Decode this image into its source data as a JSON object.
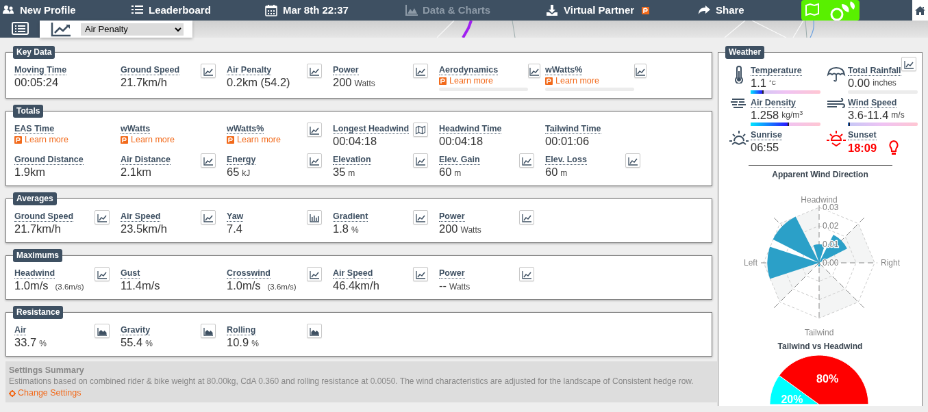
{
  "nav": [
    {
      "label": "New Profile",
      "disabled": false,
      "badge": false
    },
    {
      "label": "Leaderboard",
      "disabled": false,
      "badge": false
    },
    {
      "label": "Mar 8th 22:37",
      "disabled": false,
      "badge": false
    },
    {
      "label": "Data & Charts",
      "disabled": true,
      "badge": false
    },
    {
      "label": "Virtual Partner",
      "disabled": false,
      "badge": true
    },
    {
      "label": "Share",
      "disabled": false,
      "badge": false
    }
  ],
  "metric_selector": {
    "value": "Air Penalty"
  },
  "sections": [
    {
      "title": "Key Data",
      "items": [
        {
          "label": "Moving Time",
          "value": "00:05:24",
          "kind": "none"
        },
        {
          "label": "Ground Speed",
          "value": "21.7km/h",
          "kind": "line"
        },
        {
          "label": "Air Penalty",
          "value": "0.2km (54.2)",
          "kind": "line"
        },
        {
          "label": "Power",
          "value": "200",
          "unit": "Watts",
          "kind": "line"
        },
        {
          "label": "Aerodynamics",
          "link": "Learn more",
          "bar": true,
          "kind": "line"
        },
        {
          "label": "wWatts%",
          "link": "Learn more",
          "bar": true,
          "kind": "line"
        }
      ]
    },
    {
      "title": "Totals",
      "items": [
        {
          "label": "EAS Time",
          "link": "Learn more",
          "kind": "none"
        },
        {
          "label": "wWatts",
          "link": "Learn more",
          "kind": "none"
        },
        {
          "label": "wWatts%",
          "link": "Learn more",
          "kind": "line"
        },
        {
          "label": "Longest Headwind",
          "value": "00:04:18",
          "kind": "map"
        },
        {
          "label": "Headwind Time",
          "value": "00:04:18",
          "kind": "none"
        },
        {
          "label": "Tailwind Time",
          "value": "00:01:06",
          "kind": "none"
        },
        {
          "label": "Ground Distance",
          "value": "1.9km",
          "kind": "none"
        },
        {
          "label": "Air Distance",
          "value": "2.1km",
          "kind": "line"
        },
        {
          "label": "Energy",
          "value": "65",
          "unit": "kJ",
          "kind": "line"
        },
        {
          "label": "Elevation",
          "value": "35",
          "unit": "m",
          "kind": "line"
        },
        {
          "label": "Elev. Gain",
          "value": "60",
          "unit": "m",
          "kind": "line"
        },
        {
          "label": "Elev. Loss",
          "value": "60",
          "unit": "m",
          "kind": "line"
        }
      ]
    },
    {
      "title": "Averages",
      "items": [
        {
          "label": "Ground Speed",
          "value": "21.7km/h",
          "kind": "line"
        },
        {
          "label": "Air Speed",
          "value": "23.5km/h",
          "kind": "line"
        },
        {
          "label": "Yaw",
          "value": "7.4",
          "kind": "bar"
        },
        {
          "label": "Gradient",
          "value": "1.8",
          "unit": "%",
          "kind": "line"
        },
        {
          "label": "Power",
          "value": "200",
          "unit": "Watts",
          "kind": "line"
        }
      ]
    },
    {
      "title": "Maximums",
      "items": [
        {
          "label": "Headwind",
          "value": "1.0m/s",
          "note": "(3.6m/s)",
          "kind": "line"
        },
        {
          "label": "Gust",
          "value": "11.4m/s",
          "kind": "none"
        },
        {
          "label": "Crosswind",
          "value": "1.0m/s",
          "note": "(3.6m/s)",
          "kind": "line"
        },
        {
          "label": "Air Speed",
          "value": "46.4km/h",
          "kind": "line"
        },
        {
          "label": "Power",
          "value": "--",
          "unit": "Watts",
          "kind": "line"
        }
      ]
    },
    {
      "title": "Resistance",
      "items": [
        {
          "label": "Air",
          "value": "33.7",
          "unit": "%",
          "kind": "area"
        },
        {
          "label": "Gravity",
          "value": "55.4",
          "unit": "%",
          "kind": "area"
        },
        {
          "label": "Rolling",
          "value": "10.9",
          "unit": "%",
          "kind": "area"
        }
      ]
    }
  ],
  "settings": {
    "title": "Settings Summary",
    "text": "Estimations based on combined rider & bike weight at 80.00kg, CdA 0.360 and rolling resistance at 0.0050. The wind characteristics are adjusted for the landscape of Consistent hedge row.",
    "link": "Change Settings"
  },
  "weather": {
    "title": "Weather",
    "items": [
      {
        "label": "Temperature",
        "value": "1.1",
        "unit": "°C",
        "bar": {
          "kind": "gradient",
          "level": 0.19
        }
      },
      {
        "label": "Total Rainfall",
        "value": "0.00",
        "unit": "inches",
        "bar": {
          "kind": "plain",
          "level": 0
        }
      },
      {
        "label": "Air Density",
        "value": "1.258",
        "unit": "kg/m$^{3}$",
        "bar": {
          "kind": "gradient",
          "level": 0.55
        }
      },
      {
        "label": "Wind Speed",
        "value": "3.6-11.4",
        "unit": "m/s",
        "bar": {
          "kind": "gradient",
          "level": 0.03
        }
      },
      {
        "label": "Sunrise",
        "value": "06:55",
        "alert": false,
        "hint": false
      },
      {
        "label": "Sunset",
        "value": "18:09",
        "alert": true,
        "hint": true
      }
    ],
    "wind_chart": {
      "title": "Apparent Wind Direction",
      "directions": [
        "Headwind",
        "Right",
        "Tailwind",
        "Left"
      ],
      "ring_labels": [
        "0.03",
        "0.02",
        "0.01",
        "0.00"
      ]
    },
    "share_chart": {
      "chart_data": {
        "type": "pie",
        "title": "Tailwind vs Headwind",
        "values": [
          20,
          80
        ],
        "value_labels": [
          "20%",
          "80%"
        ]
      }
    }
  }
}
